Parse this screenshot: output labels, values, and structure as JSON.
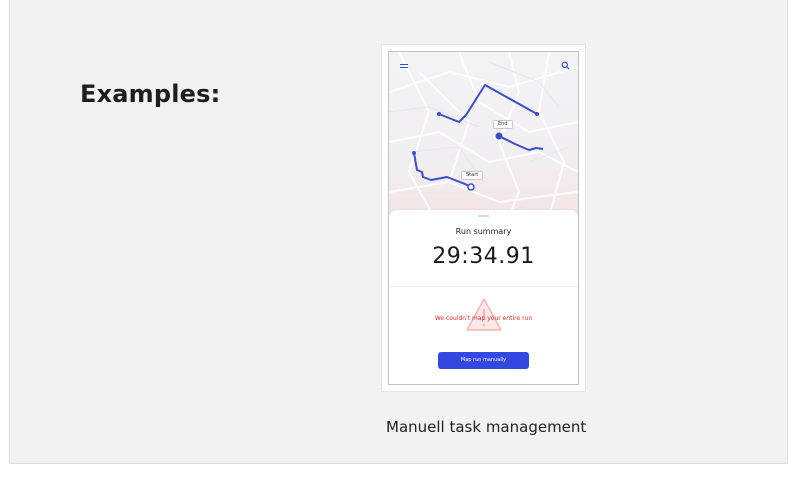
{
  "slide": {
    "heading": "Examples:",
    "caption": "Manuell task management"
  },
  "phone": {
    "top_bar": {
      "menu_icon": "menu-icon",
      "search_icon": "search-icon"
    },
    "map": {
      "end_label": "End",
      "start_label": "Start",
      "route_color": "#3a4ec8"
    },
    "summary": {
      "title": "Run summary",
      "time": "29:34.91",
      "error_message": "We couldn't map your entire run",
      "warning_icon": "warning-icon",
      "button_label": "Map run manually",
      "button_color": "#3348e0",
      "error_color": "#e02b2b"
    }
  }
}
